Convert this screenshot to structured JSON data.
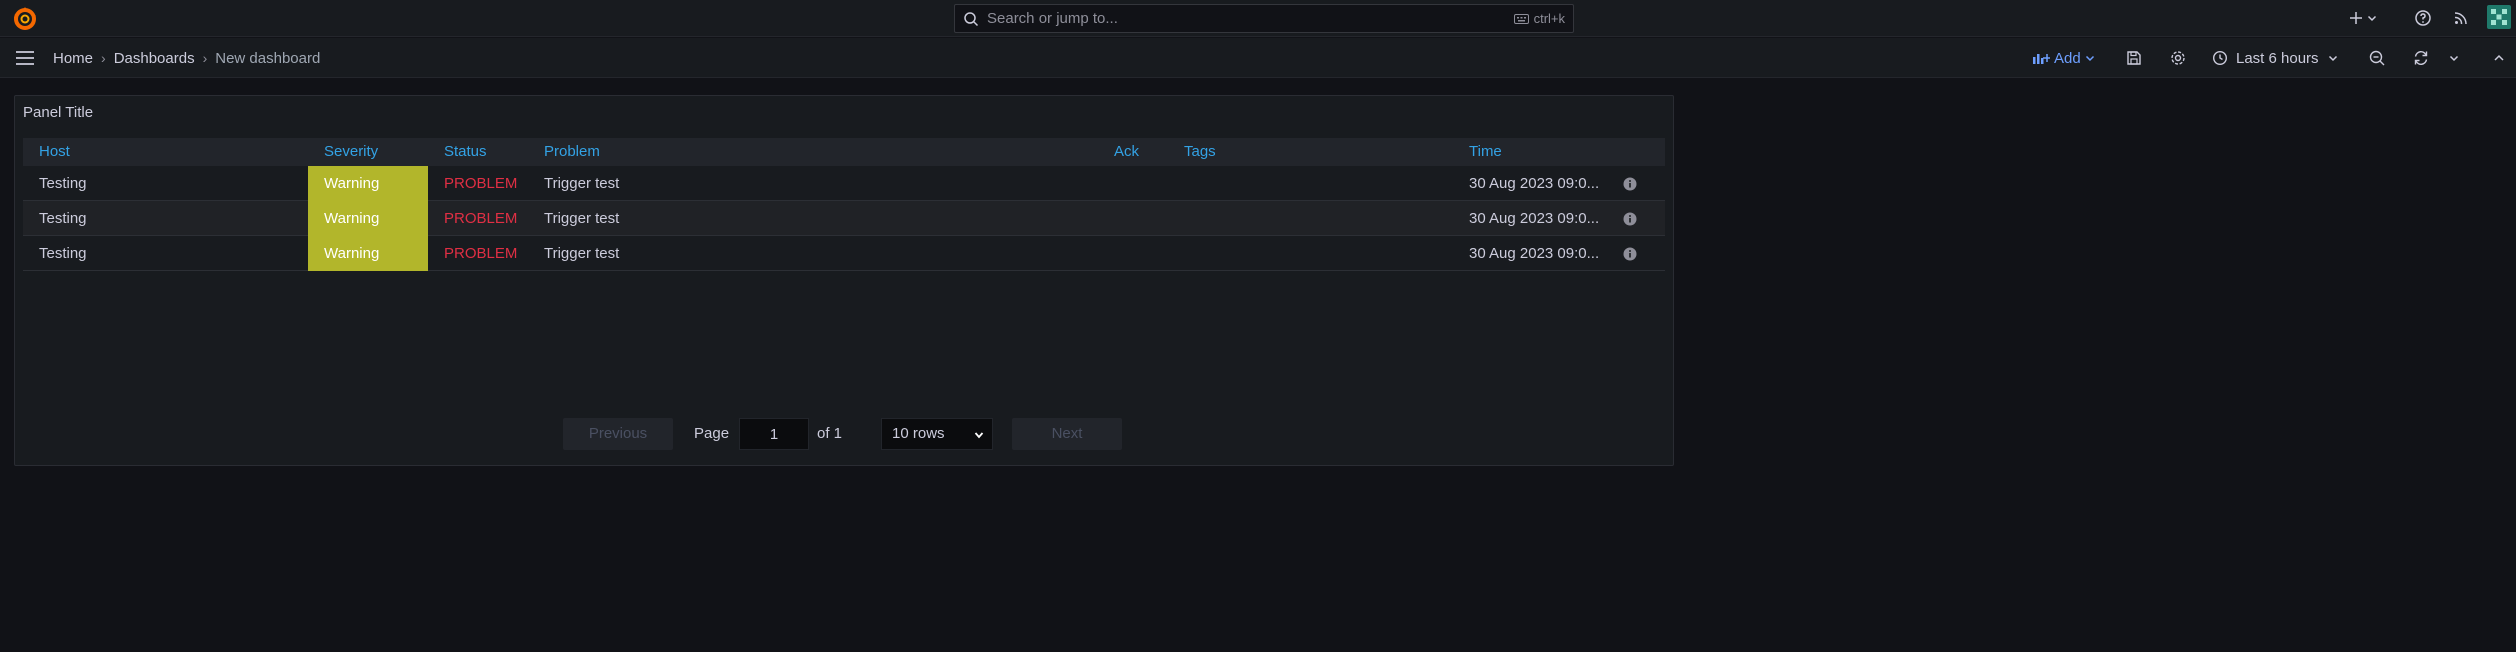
{
  "topbar": {
    "search_placeholder": "Search or jump to...",
    "search_shortcut": "ctrl+k"
  },
  "navbar": {
    "breadcrumb": [
      "Home",
      "Dashboards",
      "New dashboard"
    ],
    "add_label": "Add",
    "time_range": "Last 6 hours"
  },
  "panel": {
    "title": "Panel Title",
    "columns": [
      "Host",
      "Severity",
      "Status",
      "Problem",
      "Ack",
      "Tags",
      "Time"
    ],
    "rows": [
      {
        "host": "Testing",
        "severity": "Warning",
        "status": "PROBLEM",
        "problem": "Trigger test",
        "ack": "",
        "tags": "",
        "time": "30 Aug 2023 09:0..."
      },
      {
        "host": "Testing",
        "severity": "Warning",
        "status": "PROBLEM",
        "problem": "Trigger test",
        "ack": "",
        "tags": "",
        "time": "30 Aug 2023 09:0..."
      },
      {
        "host": "Testing",
        "severity": "Warning",
        "status": "PROBLEM",
        "problem": "Trigger test",
        "ack": "",
        "tags": "",
        "time": "30 Aug 2023 09:0..."
      }
    ],
    "pagination": {
      "previous": "Previous",
      "page_label": "Page",
      "page_value": "1",
      "of_label": "of 1",
      "rows_option": "10 rows",
      "next": "Next"
    }
  },
  "colors": {
    "accent": "#33a2e5",
    "warning": "#b2b62b",
    "problem": "#e02f44",
    "add": "#6e9fff"
  }
}
